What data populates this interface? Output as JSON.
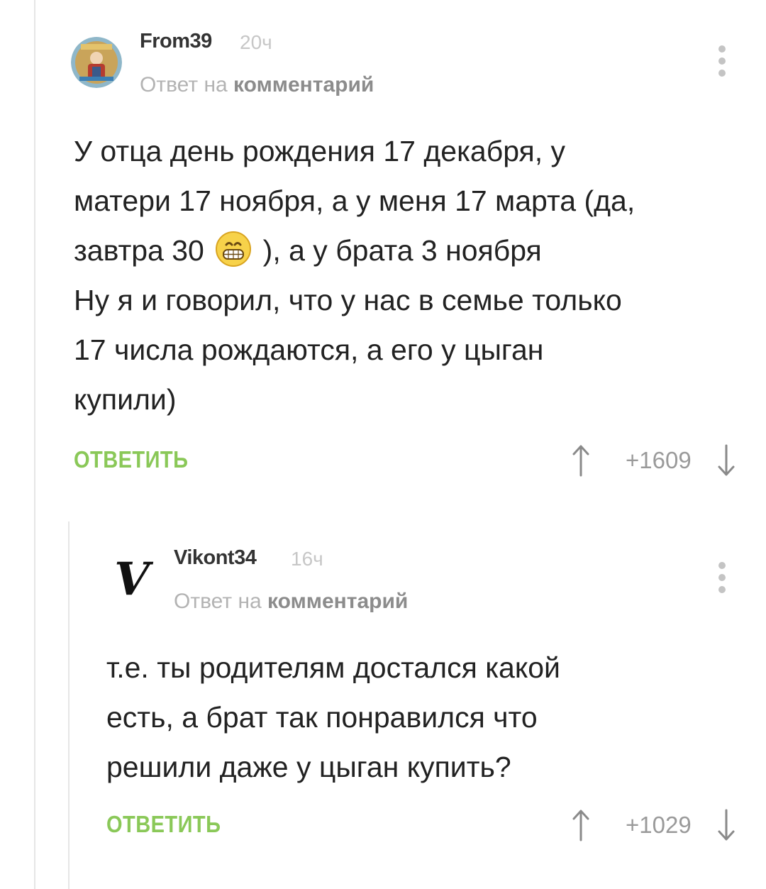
{
  "comments": [
    {
      "username": "From39",
      "time": "20ч",
      "reply_prefix": "Ответ на",
      "reply_target": "комментарий",
      "text_lines": [
        "У отца день рождения 17 декабря, у",
        "матери 17 ноября, а у меня 17 марта (да,"
      ],
      "text_before_emoji": "завтра 30",
      "emoji": "grinning-face-emoji",
      "text_after_emoji": "), а у брата 3 ноября",
      "text_lines_after": [
        "Ну я и говорил, что у нас в семье только",
        "17 числа рождаются, а его у цыган",
        "купили)"
      ],
      "reply_label": "ОТВЕТИТЬ",
      "score": "+1609"
    },
    {
      "username": "Vikont34",
      "time": "16ч",
      "reply_prefix": "Ответ на",
      "reply_target": "комментарий",
      "avatar_letter": "V",
      "text_lines": [
        "т.е. ты родителям достался какой",
        "есть, а брат так понравился что",
        "решили даже у цыган купить?"
      ],
      "reply_label": "ОТВЕТИТЬ",
      "score": "+1029"
    }
  ],
  "colors": {
    "accent_green": "#8ac858",
    "muted_text": "#b3b3b3",
    "thread_line": "#e6e6e6"
  }
}
